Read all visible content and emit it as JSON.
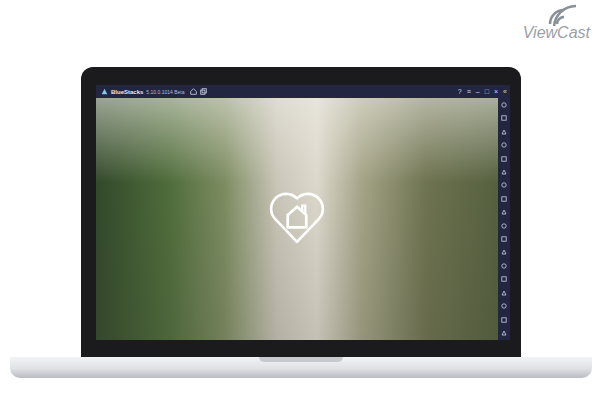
{
  "logo": {
    "text": "ViewCast"
  },
  "window": {
    "title": "BlueStacks",
    "version": "5.10.0.1014 Beta",
    "controls": [
      "?",
      "≡",
      "–",
      "□",
      "×",
      "«"
    ]
  },
  "sidebar": {
    "count": 18
  }
}
